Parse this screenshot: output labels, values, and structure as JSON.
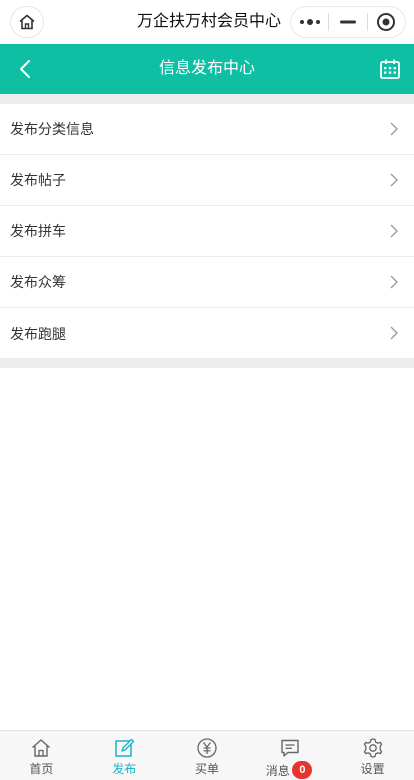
{
  "topbar": {
    "title": "万企扶万村会员中心"
  },
  "header": {
    "title": "信息发布中心"
  },
  "menu": {
    "items": [
      {
        "label": "发布分类信息"
      },
      {
        "label": "发布帖子"
      },
      {
        "label": "发布拼车"
      },
      {
        "label": "发布众筹"
      },
      {
        "label": "发布跑腿"
      }
    ]
  },
  "tabbar": {
    "tabs": [
      {
        "label": "首页",
        "icon": "home-icon"
      },
      {
        "label": "发布",
        "icon": "edit-icon",
        "active": true
      },
      {
        "label": "买单",
        "icon": "yen-icon"
      },
      {
        "label": "消息",
        "icon": "message-icon",
        "badge": "0"
      },
      {
        "label": "设置",
        "icon": "gear-icon"
      }
    ]
  },
  "colors": {
    "header_bg": "#0fbfa3",
    "active_tab": "#16b5c8",
    "badge": "#e8342f"
  }
}
